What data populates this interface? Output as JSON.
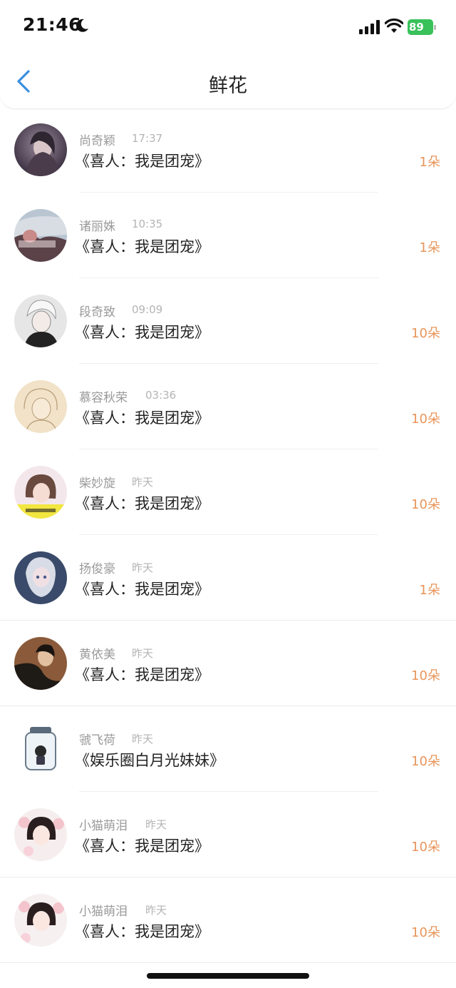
{
  "status_bar": {
    "time": "21:46",
    "battery": "89"
  },
  "nav": {
    "title": "鲜花"
  },
  "items": [
    {
      "name": "尚奇颖",
      "time": "17:37",
      "book": "《喜人：我是团宠》",
      "count": "1朵"
    },
    {
      "name": "诸丽姝",
      "time": "10:35",
      "book": "《喜人：我是团宠》",
      "count": "1朵"
    },
    {
      "name": "段奇致",
      "time": "09:09",
      "book": "《喜人：我是团宠》",
      "count": "10朵"
    },
    {
      "name": "慕容秋荣",
      "time": "03:36",
      "book": "《喜人：我是团宠》",
      "count": "10朵"
    },
    {
      "name": "柴妙旋",
      "time": "昨天",
      "book": "《喜人：我是团宠》",
      "count": "10朵"
    },
    {
      "name": "扬俊豪",
      "time": "昨天",
      "book": "《喜人：我是团宠》",
      "count": "1朵"
    },
    {
      "name": "黄依美",
      "time": "昨天",
      "book": "《喜人：我是团宠》",
      "count": "10朵"
    },
    {
      "name": "虢飞荷",
      "time": "昨天",
      "book": "《娱乐圈白月光妹妹》",
      "count": "10朵"
    },
    {
      "name": "小猫萌泪",
      "time": "昨天",
      "book": "《喜人：我是团宠》",
      "count": "10朵"
    },
    {
      "name": "小猫萌泪",
      "time": "昨天",
      "book": "《喜人：我是团宠》",
      "count": "10朵"
    }
  ]
}
